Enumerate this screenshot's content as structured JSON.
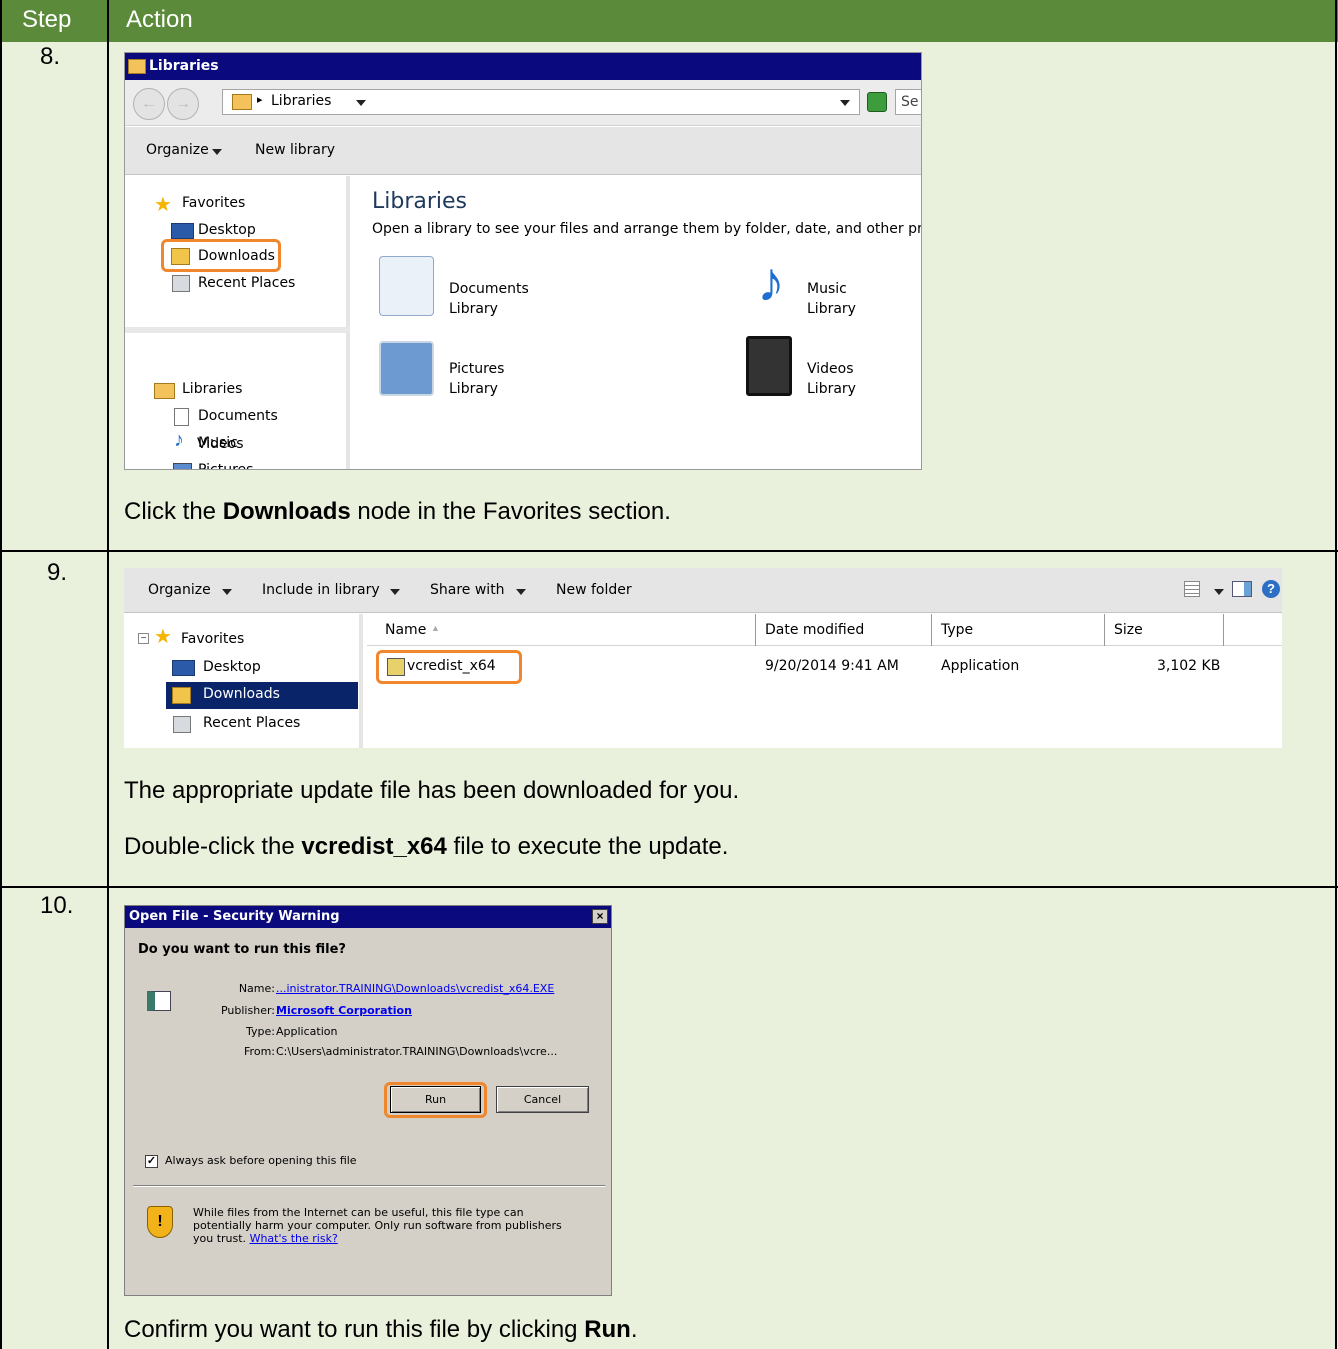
{
  "table": {
    "header_step": "Step",
    "header_action": "Action",
    "colors": {
      "header": "#5a8a3a",
      "cell": "#e9f0dc",
      "highlight": "#f0872d",
      "titlebar": "#0a0a7e"
    }
  },
  "step8": {
    "number": "8.",
    "window_title": "Libraries",
    "address_sep": "▸",
    "address_text": "Libraries",
    "search_stub": "Se",
    "toolbar": {
      "organize": "Organize",
      "new_library": "New library"
    },
    "nav": {
      "favorites": "Favorites",
      "desktop": "Desktop",
      "downloads": "Downloads",
      "recent": "Recent Places",
      "libraries": "Libraries",
      "documents": "Documents",
      "music": "Music",
      "pictures": "Pictures",
      "videos": "Videos"
    },
    "content_title": "Libraries",
    "content_desc": "Open a library to see your files and arrange them by folder, date, and other prop",
    "library_items": {
      "documents_name": "Documents",
      "documents_sub": "Library",
      "music_name": "Music",
      "music_sub": "Library",
      "pictures_name": "Pictures",
      "pictures_sub": "Library",
      "videos_name": "Videos",
      "videos_sub": "Library"
    },
    "instruction_pre": "Click the ",
    "instruction_bold": "Downloads",
    "instruction_post": " node in the Favorites section."
  },
  "step9": {
    "number": "9.",
    "toolbar": {
      "organize": "Organize",
      "include": "Include in library",
      "share": "Share with",
      "new_folder": "New folder"
    },
    "nav": {
      "favorites": "Favorites",
      "desktop": "Desktop",
      "downloads": "Downloads",
      "recent": "Recent Places"
    },
    "columns": {
      "name": "Name",
      "date": "Date modified",
      "type": "Type",
      "size": "Size"
    },
    "file": {
      "name": "vcredist_x64",
      "date": "9/20/2014 9:41 AM",
      "type": "Application",
      "size": "3,102 KB"
    },
    "instruction1": "The appropriate update file has been downloaded for you.",
    "instruction2_pre": "Double-click the ",
    "instruction2_bold": "vcredist_x64",
    "instruction2_post": " file to execute the update."
  },
  "step10": {
    "number": "10.",
    "dialog_title": "Open File - Security Warning",
    "close": "×",
    "question": "Do you want to run this file?",
    "labels": {
      "name": "Name:",
      "publisher": "Publisher:",
      "type": "Type:",
      "from": "From:"
    },
    "values": {
      "name": "...inistrator.TRAINING\\Downloads\\vcredist_x64.EXE",
      "publisher": "Microsoft Corporation",
      "type": "Application",
      "from": "C:\\Users\\administrator.TRAINING\\Downloads\\vcre..."
    },
    "run": "Run",
    "cancel": "Cancel",
    "checkbox_label": "Always ask before opening this file",
    "checkbox_checked": true,
    "warning_line1": "While files from the Internet can be useful, this file type can",
    "warning_line2": "potentially harm your computer. Only run software from publishers",
    "warning_line3": "you trust. ",
    "warning_link": "What's the risk?",
    "instruction_pre": "Confirm you want to run this file by clicking ",
    "instruction_bold": "Run",
    "instruction_post": "."
  }
}
